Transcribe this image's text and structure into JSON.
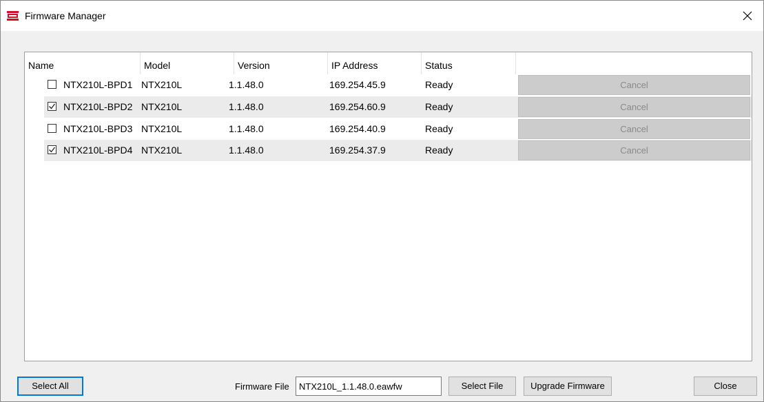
{
  "window": {
    "title": "Firmware Manager",
    "close_glyph": "✕",
    "icon": "app-logo-icon",
    "accent_color": "#d0112b"
  },
  "table": {
    "headers": [
      "Name",
      "Model",
      "Version",
      "IP Address",
      "Status"
    ],
    "rows": [
      {
        "checked": false,
        "name": "NTX210L-BPD1",
        "model": "NTX210L",
        "version": "1.1.48.0",
        "ip": "169.254.45.9",
        "status": "Ready",
        "action": "Cancel"
      },
      {
        "checked": true,
        "name": "NTX210L-BPD2",
        "model": "NTX210L",
        "version": "1.1.48.0",
        "ip": "169.254.60.9",
        "status": "Ready",
        "action": "Cancel"
      },
      {
        "checked": false,
        "name": "NTX210L-BPD3",
        "model": "NTX210L",
        "version": "1.1.48.0",
        "ip": "169.254.40.9",
        "status": "Ready",
        "action": "Cancel"
      },
      {
        "checked": true,
        "name": "NTX210L-BPD4",
        "model": "NTX210L",
        "version": "1.1.48.0",
        "ip": "169.254.37.9",
        "status": "Ready",
        "action": "Cancel"
      }
    ]
  },
  "footer": {
    "select_all_label": "Select All",
    "firmware_file_label": "Firmware File",
    "firmware_file_value": "NTX210L_1.1.48.0.eawfw",
    "select_file_label": "Select File",
    "upgrade_label": "Upgrade Firmware",
    "close_label": "Close"
  }
}
